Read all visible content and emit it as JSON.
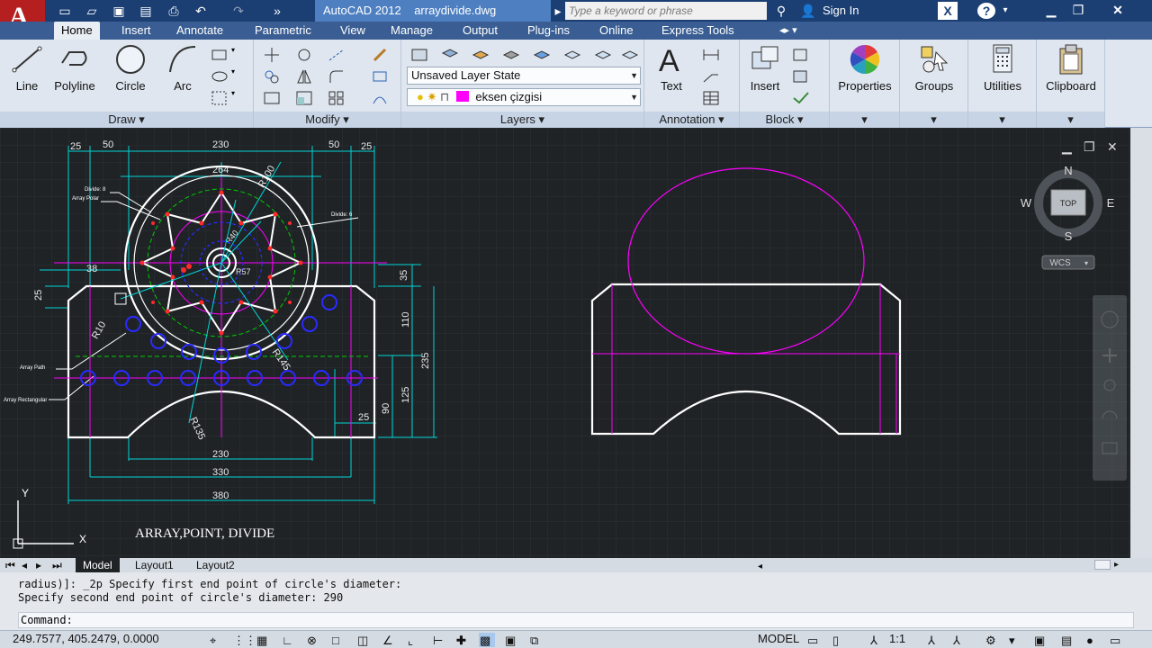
{
  "titlebar": {
    "app_title": "AutoCAD 2012",
    "file_name": "arraydivide.dwg",
    "search_placeholder": "Type a keyword or phrase",
    "sign_in": "Sign In",
    "help": "?"
  },
  "tabs": [
    "Home",
    "Insert",
    "Annotate",
    "Parametric",
    "View",
    "Manage",
    "Output",
    "Plug-ins",
    "Online",
    "Express Tools"
  ],
  "ribbon": {
    "draw": {
      "title": "Draw",
      "line": "Line",
      "polyline": "Polyline",
      "circle": "Circle",
      "arc": "Arc"
    },
    "modify": {
      "title": "Modify"
    },
    "layers": {
      "title": "Layers",
      "layer_state": "Unsaved Layer State",
      "current_layer": "eksen çizgisi",
      "layer_color": "#ff00ff"
    },
    "annotation": {
      "title": "Annotation",
      "text": "Text"
    },
    "block": {
      "title": "Block",
      "insert": "Insert"
    },
    "properties": "Properties",
    "groups": "Groups",
    "utilities": "Utilities",
    "clipboard": "Clipboard"
  },
  "viewcube": {
    "n": "N",
    "s": "S",
    "e": "E",
    "w": "W",
    "top": "TOP",
    "wcs": "WCS"
  },
  "drawing": {
    "title": "ARRAY,POINT, DIVIDE",
    "dims": {
      "d25a": "25",
      "d50a": "50",
      "d230top": "230",
      "d50b": "50",
      "d25b": "25",
      "d264": "264",
      "r100": "R100",
      "d38": "38",
      "d25c": "25",
      "d35": "35",
      "d110": "110",
      "d235": "235",
      "d125": "125",
      "d90": "90",
      "d25d": "25",
      "r10": "R10",
      "r145": "R145",
      "r135": "R135",
      "d230bot": "230",
      "d330": "330",
      "d380": "380",
      "r40": "R40",
      "r57": "R57"
    },
    "callouts": {
      "divide8": "Divide: 8",
      "array_polar": "Array Polar",
      "divide6": "Divide: 6",
      "array_path": "Array Path",
      "array_rect": "Array Rectangular"
    },
    "ucs": {
      "x": "X",
      "y": "Y"
    }
  },
  "layout_tabs": [
    "Model",
    "Layout1",
    "Layout2"
  ],
  "command": {
    "line1": "radius)]: _2p Specify first end point of circle's diameter:",
    "line2": "Specify second end point of circle's diameter: 290",
    "prompt": "Command:"
  },
  "status": {
    "coords": "249.7577, 405.2479, 0.0000",
    "model": "MODEL",
    "scale": "1:1"
  }
}
